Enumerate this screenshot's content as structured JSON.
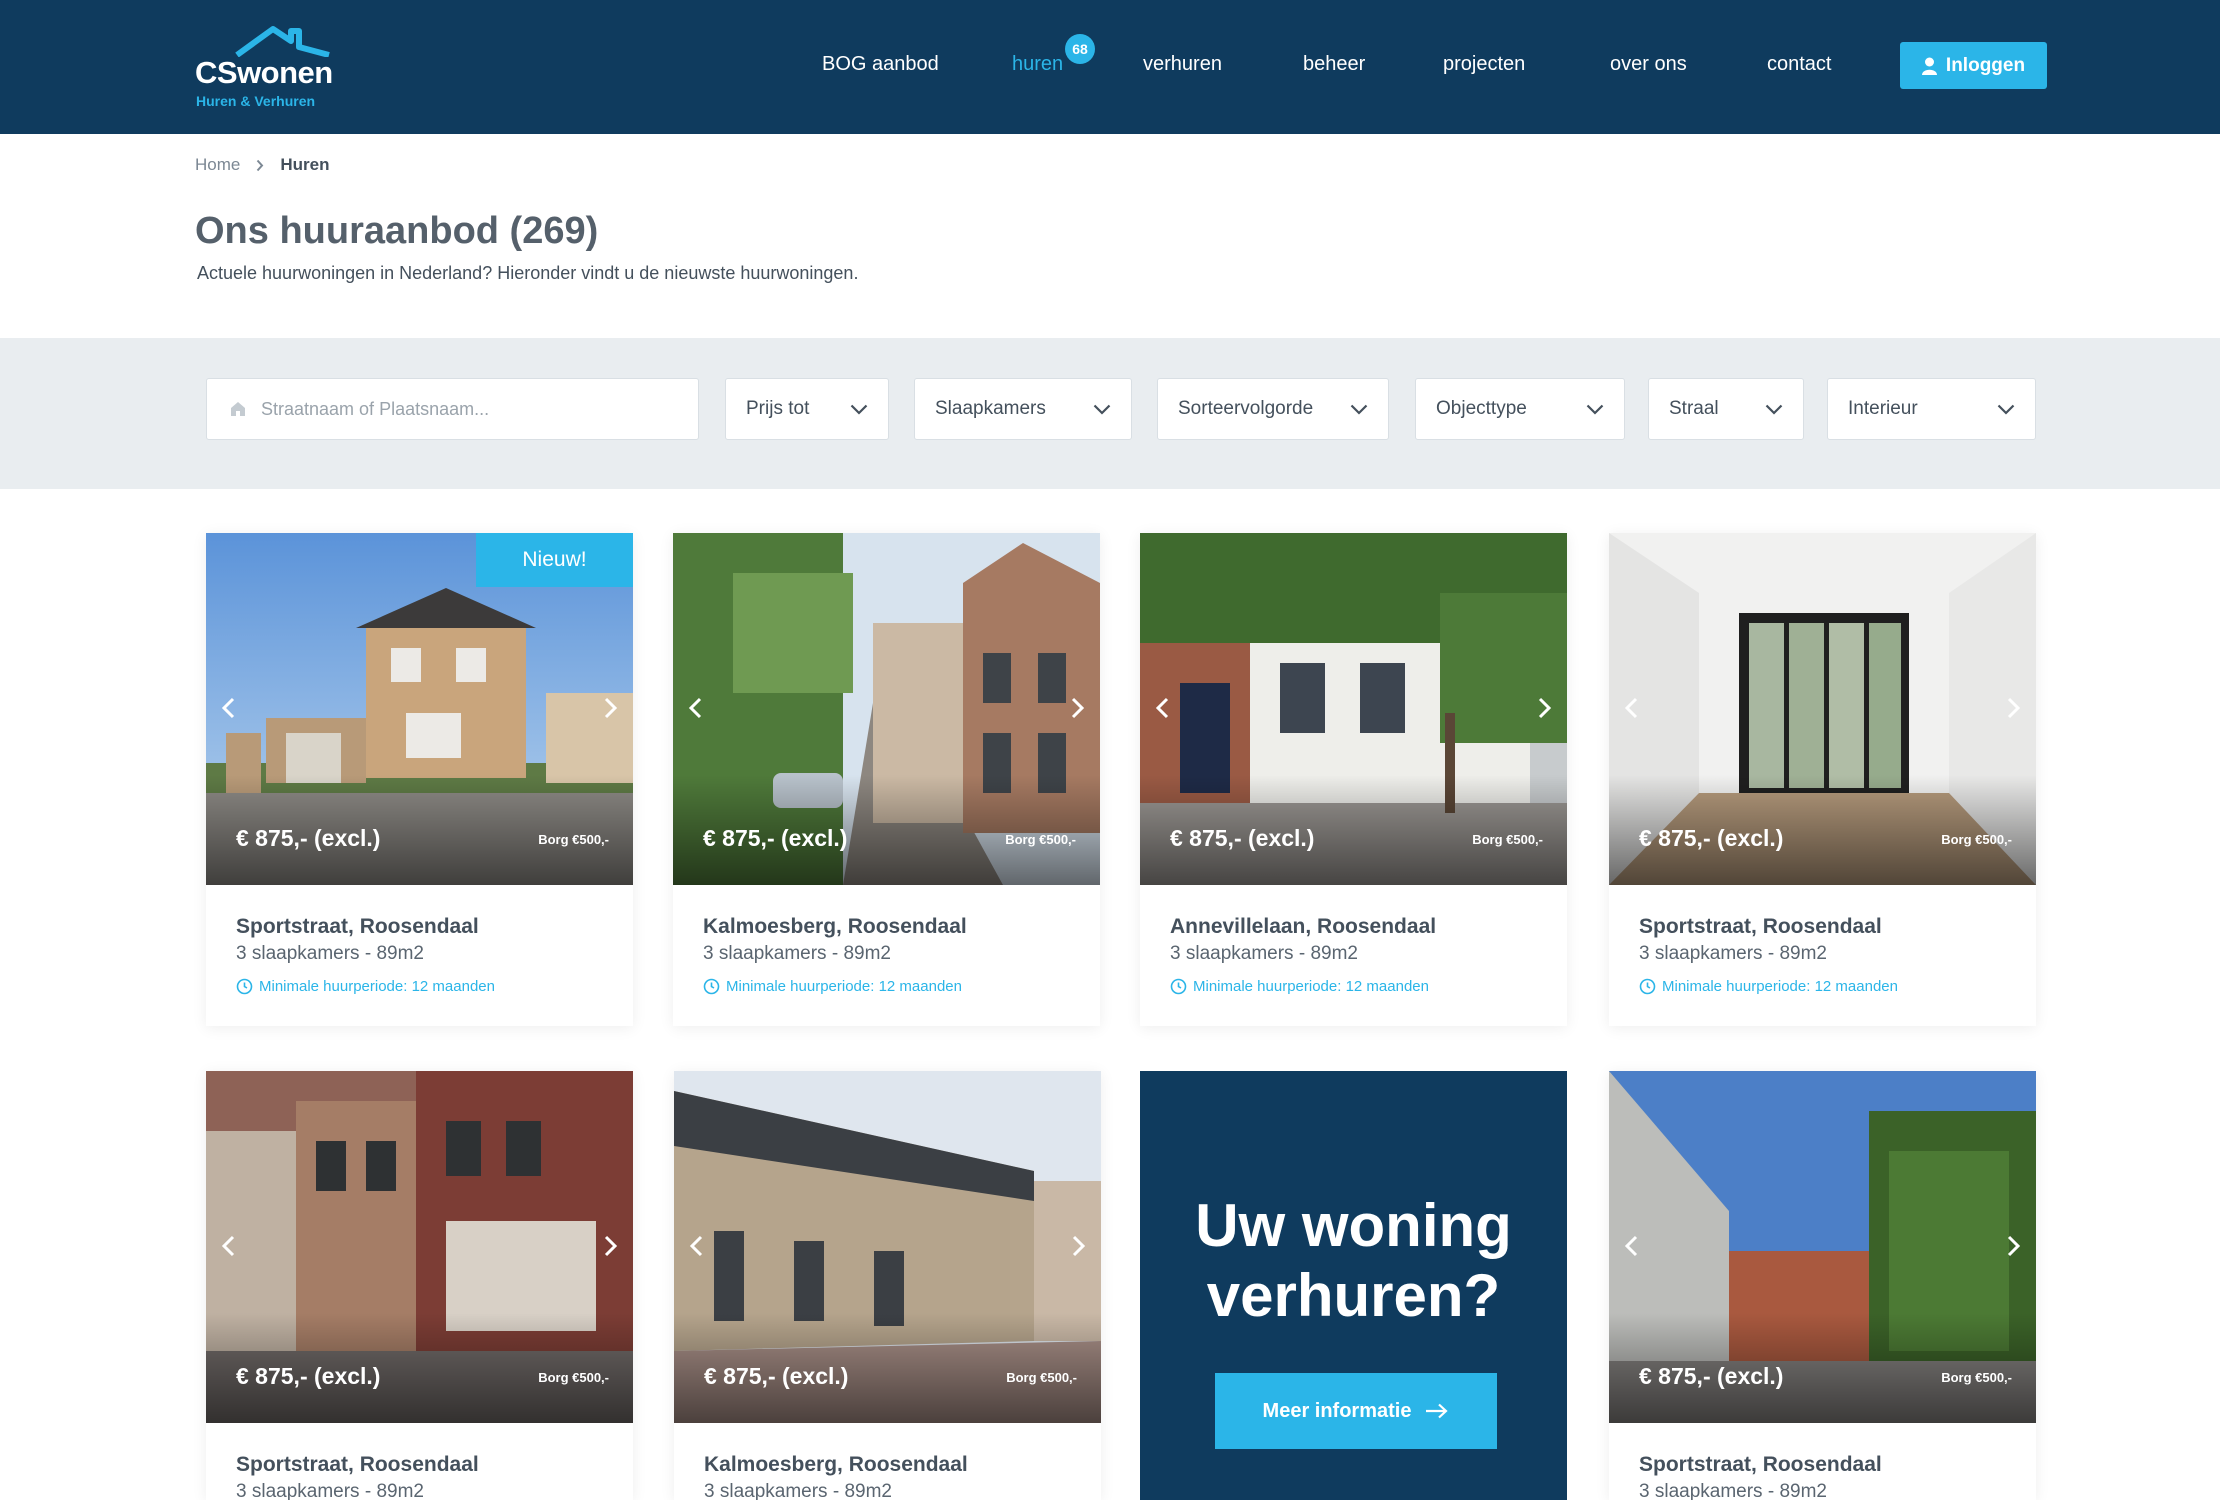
{
  "brand": {
    "name": "CSwonen",
    "tagline": "Huren & Verhuren"
  },
  "nav": {
    "items": [
      {
        "label": "BOG aanbod"
      },
      {
        "label": "huren",
        "badge": "68",
        "active": true
      },
      {
        "label": "verhuren"
      },
      {
        "label": "beheer"
      },
      {
        "label": "projecten"
      },
      {
        "label": "over ons"
      },
      {
        "label": "contact"
      }
    ],
    "login_label": "Inloggen"
  },
  "breadcrumb": {
    "home": "Home",
    "current": "Huren"
  },
  "page": {
    "title": "Ons huuraanbod (269)",
    "subtitle": "Actuele huurwoningen in Nederland? Hieronder vindt u de nieuwste huurwoningen."
  },
  "filters": {
    "search_placeholder": "Straatnaam of Plaatsnaam...",
    "selects": [
      {
        "label": "Prijs tot"
      },
      {
        "label": "Slaapkamers"
      },
      {
        "label": "Sorteervolgorde"
      },
      {
        "label": "Objecttype"
      },
      {
        "label": "Straal"
      },
      {
        "label": "Interieur"
      }
    ]
  },
  "listings": [
    {
      "title": "Sportstraat, Roosendaal",
      "meta": "3 slaapkamers - 89m2",
      "price": "€ 875,- (excl.)",
      "deposit": "Borg €500,-",
      "period": "Minimale huurperiode: 12 maanden",
      "tag": "Nieuw!"
    },
    {
      "title": "Kalmoesberg, Roosendaal",
      "meta": "3 slaapkamers - 89m2",
      "price": "€ 875,- (excl.)",
      "deposit": "Borg €500,-",
      "period": "Minimale huurperiode: 12 maanden"
    },
    {
      "title": "Annevillelaan, Roosendaal",
      "meta": "3 slaapkamers - 89m2",
      "price": "€ 875,- (excl.)",
      "deposit": "Borg €500,-",
      "period": "Minimale huurperiode: 12 maanden"
    },
    {
      "title": "Sportstraat, Roosendaal",
      "meta": "3 slaapkamers - 89m2",
      "price": "€ 875,- (excl.)",
      "deposit": "Borg €500,-",
      "period": "Minimale huurperiode: 12 maanden"
    },
    {
      "title": "Sportstraat, Roosendaal",
      "meta": "3 slaapkamers - 89m2",
      "price": "€ 875,- (excl.)",
      "deposit": "Borg €500,-"
    },
    {
      "title": "Kalmoesberg, Roosendaal",
      "meta": "3 slaapkamers - 89m2",
      "price": "€ 875,- (excl.)",
      "deposit": "Borg €500,-"
    },
    {
      "title": "Sportstraat, Roosendaal",
      "meta": "3 slaapkamers - 89m2",
      "price": "€ 875,- (excl.)",
      "deposit": "Borg €500,-"
    }
  ],
  "promo": {
    "title": "Uw woning\nverhuren?",
    "button_label": "Meer informatie"
  },
  "colors": {
    "navy": "#0f3b5e",
    "accent": "#2bb5e8",
    "text": "#44505c",
    "filter_bg": "#e9edf0"
  }
}
